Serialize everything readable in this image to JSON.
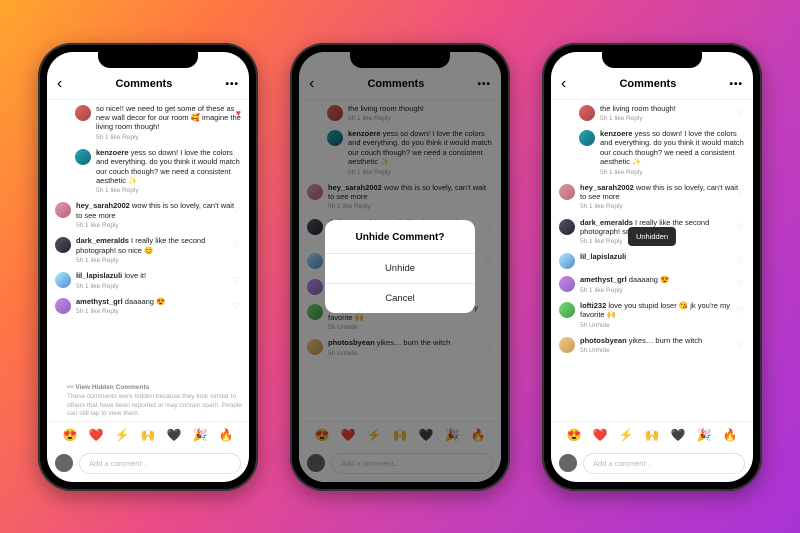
{
  "header": {
    "title": "Comments"
  },
  "dialog": {
    "title": "Unhide Comment?",
    "unhide": "Unhide",
    "cancel": "Cancel"
  },
  "toast": "Unhidden",
  "composer": {
    "placeholder": "Add a comment..."
  },
  "emojis": [
    "😍",
    "❤️",
    "⚡",
    "🙌",
    "🖤",
    "🎉",
    "🔥"
  ],
  "hidden": {
    "link": "View Hidden Comments",
    "note": "These comments were hidden because they look similar to others that have been reported or may contain spam. People can still tap to view them."
  },
  "p1": [
    {
      "u": "",
      "t": "so nice!! we need to get some of these as new wall decor for our room 🥰 imagine the living room though!",
      "m": "5h   1 like   Reply",
      "k": "child",
      "liked": true,
      "a": "bg1"
    },
    {
      "u": "kenzoere",
      "t": " yess so down! I love the colors and everything. do you think it would match our couch though? we need a consistent aesthetic ✨",
      "m": "5h   1 like   Reply",
      "k": "child",
      "a": "bg2"
    },
    {
      "u": "hey_sarah2002",
      "t": " wow this is so lovely, can't wait to see more",
      "m": "5h   1 like   Reply",
      "a": "bg3"
    },
    {
      "u": "dark_emeralds",
      "t": " I really like the second photograph! so nice 😊",
      "m": "5h   1 like   Reply",
      "a": "bg4"
    },
    {
      "u": "lil_lapislazuli",
      "t": " love it!",
      "m": "5h   1 like   Reply",
      "a": "bg5"
    },
    {
      "u": "amethyst_grl",
      "t": " daaaang 😍",
      "m": "5h   1 like   Reply",
      "a": "bg6"
    }
  ],
  "p2": [
    {
      "u": "",
      "t": "the living room though!",
      "m": "5h   1 like   Reply",
      "k": "child",
      "a": "bg1"
    },
    {
      "u": "kenzoere",
      "t": " yess so down! I love the colors and everything. do you think it would match our couch though? we need a consistent aesthetic ✨",
      "m": "5h   1 like   Reply",
      "k": "child",
      "a": "bg2"
    },
    {
      "u": "hey_sarah2002",
      "t": " wow this is so lovely, can't wait to see more",
      "m": "5h   1 like   Reply",
      "a": "bg3"
    },
    {
      "u": "dark_emeralds",
      "t": " I really like the second photograph! so nice 😊",
      "m": "5h   1 like   Reply",
      "a": "bg4"
    },
    {
      "u": "lil_lapislazuli",
      "t": " love it!",
      "m": "5h   1 like   Reply",
      "a": "bg5"
    },
    {
      "u": "amethyst_grl",
      "t": " daaaang 😍",
      "m": "5h   1 like   Reply",
      "a": "bg6"
    },
    {
      "u": "lofti232",
      "t": " love you stupid loser 😘 jk you're my favorite 🙌",
      "m": "5h   Unhide",
      "a": "bg7"
    },
    {
      "u": "photosbyean",
      "t": " yikes… burn the witch",
      "m": "5h   Unhide",
      "a": "bg8"
    }
  ],
  "p3": [
    {
      "u": "",
      "t": "the living room though!",
      "m": "5h   1 like   Reply",
      "k": "child",
      "a": "bg1"
    },
    {
      "u": "kenzoere",
      "t": " yess so down! I love the colors and everything. do you think it would match our couch though? we need a consistent aesthetic ✨",
      "m": "5h   1 like   Reply",
      "k": "child",
      "a": "bg2"
    },
    {
      "u": "hey_sarah2002",
      "t": " wow this is so lovely, can't wait to see more",
      "m": "5h   1 like   Reply",
      "a": "bg3"
    },
    {
      "u": "dark_emeralds",
      "t": " I really like the second photograph! so nice 😊",
      "m": "5h   1 like   Reply",
      "a": "bg4"
    },
    {
      "u": "lil_lapislazuli",
      "t": "",
      "m": "",
      "a": "bg5"
    },
    {
      "u": "amethyst_grl",
      "t": " daaaang 😍",
      "m": "5h   1 like   Reply",
      "a": "bg6"
    },
    {
      "u": "lofti232",
      "t": " love you stupid loser 😘 jk you're my favorite 🙌",
      "m": "5h   Unhide",
      "a": "bg7"
    },
    {
      "u": "photosbyean",
      "t": " yikes… burn the witch",
      "m": "5h   Unhide",
      "a": "bg8"
    }
  ]
}
